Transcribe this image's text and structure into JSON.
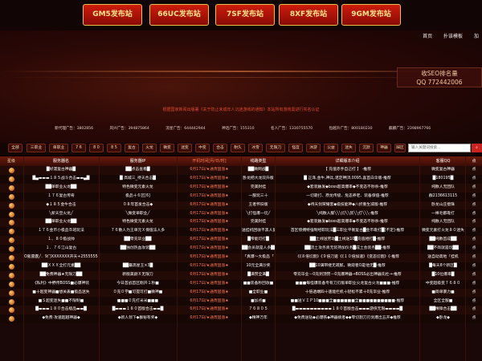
{
  "top_buttons": [
    "GM5发布站",
    "66UC发布站",
    "7SF发布站",
    "8XF发布站",
    "9GM发布站"
  ],
  "nav_links": [
    "首页",
    "扑该模板",
    "加"
  ],
  "seo_box": {
    "line1": "收SEO排名量",
    "line2": "QQ 772442006"
  },
  "notice": "根据国家新闻出版署《关于防止未成年人沉迷游戏的通知》本站所有游戏需进行实名认证",
  "ads": [
    "新代理广告：3802856",
    "风兴广告：394875864",
    "流星广告：644442944",
    "神话广告：155310",
    "名人广告：1330755570",
    "恒越升广告：800180230",
    "麒麟广告：2398967766"
  ],
  "categories": [
    "全部",
    "三职业",
    "单职业",
    "7 6",
    "8 0",
    "8 5",
    "复古",
    "火龙",
    "微变",
    "迷变",
    "中变",
    "合击",
    "耐久",
    "冰雪",
    "无限刀",
    "怪度",
    "沐游",
    "公益",
    "迷失",
    "沉默",
    "神器",
    "合击",
    "踩区"
  ],
  "search": {
    "placeholder": "输入关键词搜索..."
  },
  "table": {
    "headers": [
      "星级",
      "服务器名",
      "服务器IP",
      "开机时间[月/日/时]",
      "线路类型",
      "详细版本介绍",
      "客服QQ",
      "点"
    ],
    "rows": [
      {
        "name": "█好漫复古神器█",
        "ip": "██点击查看█",
        "time": "6月17日/★通宵固涨★",
        "line": "██微网战█",
        "info": "【 充值赤手自己打 】  -推荐",
        "qq": "微变复古神器",
        "act": "点"
      },
      {
        "name": "█▄▬▬▬１８５战斗合击▬▬▄█",
        "ip": "█ 高城三_待天合击█",
        "time": "6月17日/★通宵固涨★",
        "line": "卧龙把大龙双升版",
        "info": "█ 正泽,金牛,神兵,诺定神[8,0095,喜首白伞版-推荐",
        "qq": "█180195█",
        "act": "点"
      },
      {
        "name": "██单职业火龙██",
        "ip": "特色微变元素火龙",
        "time": "6月17日/★通宵固涨★",
        "line": "完美封挂",
        "info": "◆套装触发◆boss超高爆率◆不变态不秒杀-推荐",
        "qq": "纯散人无团队",
        "act": "点"
      },
      {
        "name": "１７６复古传奇",
        "ip": "极品十６区[6]",
        "time": "6月17日/★通宵固涨★",
        "line": "一服玩三十",
        "info": "一切靠打、原龙传极、危态养老、装备保值-推荐",
        "qq": "群2136613115",
        "act": "点"
      },
      {
        "name": "◆１８５金牛合击",
        "ip": "０８年首发合击◆",
        "time": "6月17日/★通宵固涨★",
        "line": "王者怀旧版",
        "info": "◆待天剑荣耀套◆级技能神◆八折重生减版-推荐",
        "qq": "卧龙山庄偿珠",
        "act": "点"
      },
      {
        "name": "╲新天空火龙╱",
        "ip": "╲微变单职业╱",
        "time": "6月17日/★通宵固涨★",
        "line": "╲打怪爆一切╱",
        "info": "╲纯散人服╲╲╲切╲╲装╲╲打╲╲╲-推荐",
        "qq": "一棒毛都靠打",
        "act": "点"
      },
      {
        "name": "██单职业火龙██",
        "ip": "特色微变元素火龙",
        "time": "6月17日/★通宵固涨★",
        "line": "完美封挂",
        "info": "◆套装触发◆boss超高爆率◆不变态不秒杀-推荐",
        "qq": "纯散人无团队",
        "act": "点"
      },
      {
        "name": "１７６金币小极品Ｂ班玩法",
        "ip": "７６散人为王单元Ｘ保值法人多",
        "time": "6月17日/★通宵固涨★",
        "line": "送挂机回收不黑人复古",
        "info": "首区惊拥特强制经职玩法█三职业平衡复古█金币靠打█[不定]-推荐",
        "qq": "微变元素打火龙８０迷失",
        "act": "点"
      },
      {
        "name": "１、８０极战帅",
        "ip": "██零充毕业██",
        "time": "6月17日/★通宵固涨★",
        "line": "█帝能可打█",
        "info": "██土线送劳动█土线送10█充值相打█-推荐",
        "qq": "██纯散首成██",
        "act": "点"
      },
      {
        "name": "１．７６江山复古",
        "ip": "██独创热血攻装██",
        "time": "6月17日/★通宵固涨★",
        "line": "██会员就是人多██",
        "info": "██流土攻务真无装持加仪务█成土会装务██-推荐",
        "qq": "██不简就是玩██",
        "act": "点"
      },
      {
        "name": "O氪雷霆╱．9门XXXXXXX开天+25555555XXXXXX",
        "ip": "",
        "time": "6月17日/★通宵固涨★",
        "line": "「真爆～大极品「",
        "info": "《《８倍切割》《９倍刀速《《１０倍加速》《变态切割》《-推荐",
        "qq": "送自动高地『挂机",
        "act": "点"
      },
      {
        "name": "██ＸＸＸ全打元素██",
        "ip": "██最高星王×3█",
        "time": "6月17日/★通宵固涨★",
        "line": "10元全满沙奖",
        "info": "██10满带继无疏腻，微观者O是他无█-推荐",
        "qq": "█每天8个新区█",
        "act": "点"
      },
      {
        "name": "██免费神器★无限刀██",
        "ip": "新版美颜Ｘ无限刀",
        "time": "6月17日/★通宵固涨★",
        "line": "█满赞全满█",
        "info": "零充毕业－0充到顶赞－0充爆神器→BOSS必出神器先杜→-推荐",
        "qq": "█10位爆率█",
        "act": "点"
      },
      {
        "name": "《私利》中野传BOSS■必爆神装",
        "ip": "今日首战首区刚开１秒■",
        "time": "6月17日/★通宵固涨★",
        "line": "■■装备秒回收■",
        "info": "■■■每怪爆装备专有刀刃版单职业火龙复古火龙■■■-推荐",
        "qq": "中变超级变７６８０",
        "act": "点"
      },
      {
        "name": "■十超变神器■想关表■极品迷失",
        "ip": "０充０学■可提可打■微神■",
        "time": "6月17日/★通宵固涨★",
        "line": "■全职业■",
        "info": "十倍透端四十速能拦机十轻松不累十0充毕业-推荐",
        "qq": "■简单暴力■",
        "act": "点"
      },
      {
        "name": "■Ｓ超变迷失■■不限制■",
        "ip": "■■■０充打米米■■■",
        "time": "6月17日/★通宵固涨★",
        "line": "■加点■",
        "info": "■■送ＶＩＰ10■■■全■■■■■■全■■■■■■■■■■-推荐",
        "qq": "全区全服■",
        "act": "点"
      },
      {
        "name": "█▬▬▬１８０合击极品▬▬█",
        "ip": "█▬▬▬１８０首版合击▬▬█",
        "time": "6月17日/★通宵固涨★",
        "line": "７６８０５",
        "info": "█▬▬▬▬▬▬▬▬▬▬１８０首版合击▬▬▬游侠无限▬▬▬▬█",
        "qq": "██精锋合击██",
        "act": "点"
      },
      {
        "name": "◆免费·攻速超越神器◆",
        "ip": "◆新人领下◆群秘有奖◆",
        "time": "6月17日/★通宵固涨★",
        "line": "◆精神万年",
        "info": "◆免费送钻◆必爆铁◆神器挑者◆◆零切割刀刃剑爆出五开◆推荐",
        "qq": "◆卧龙◆",
        "act": "点"
      }
    ]
  }
}
